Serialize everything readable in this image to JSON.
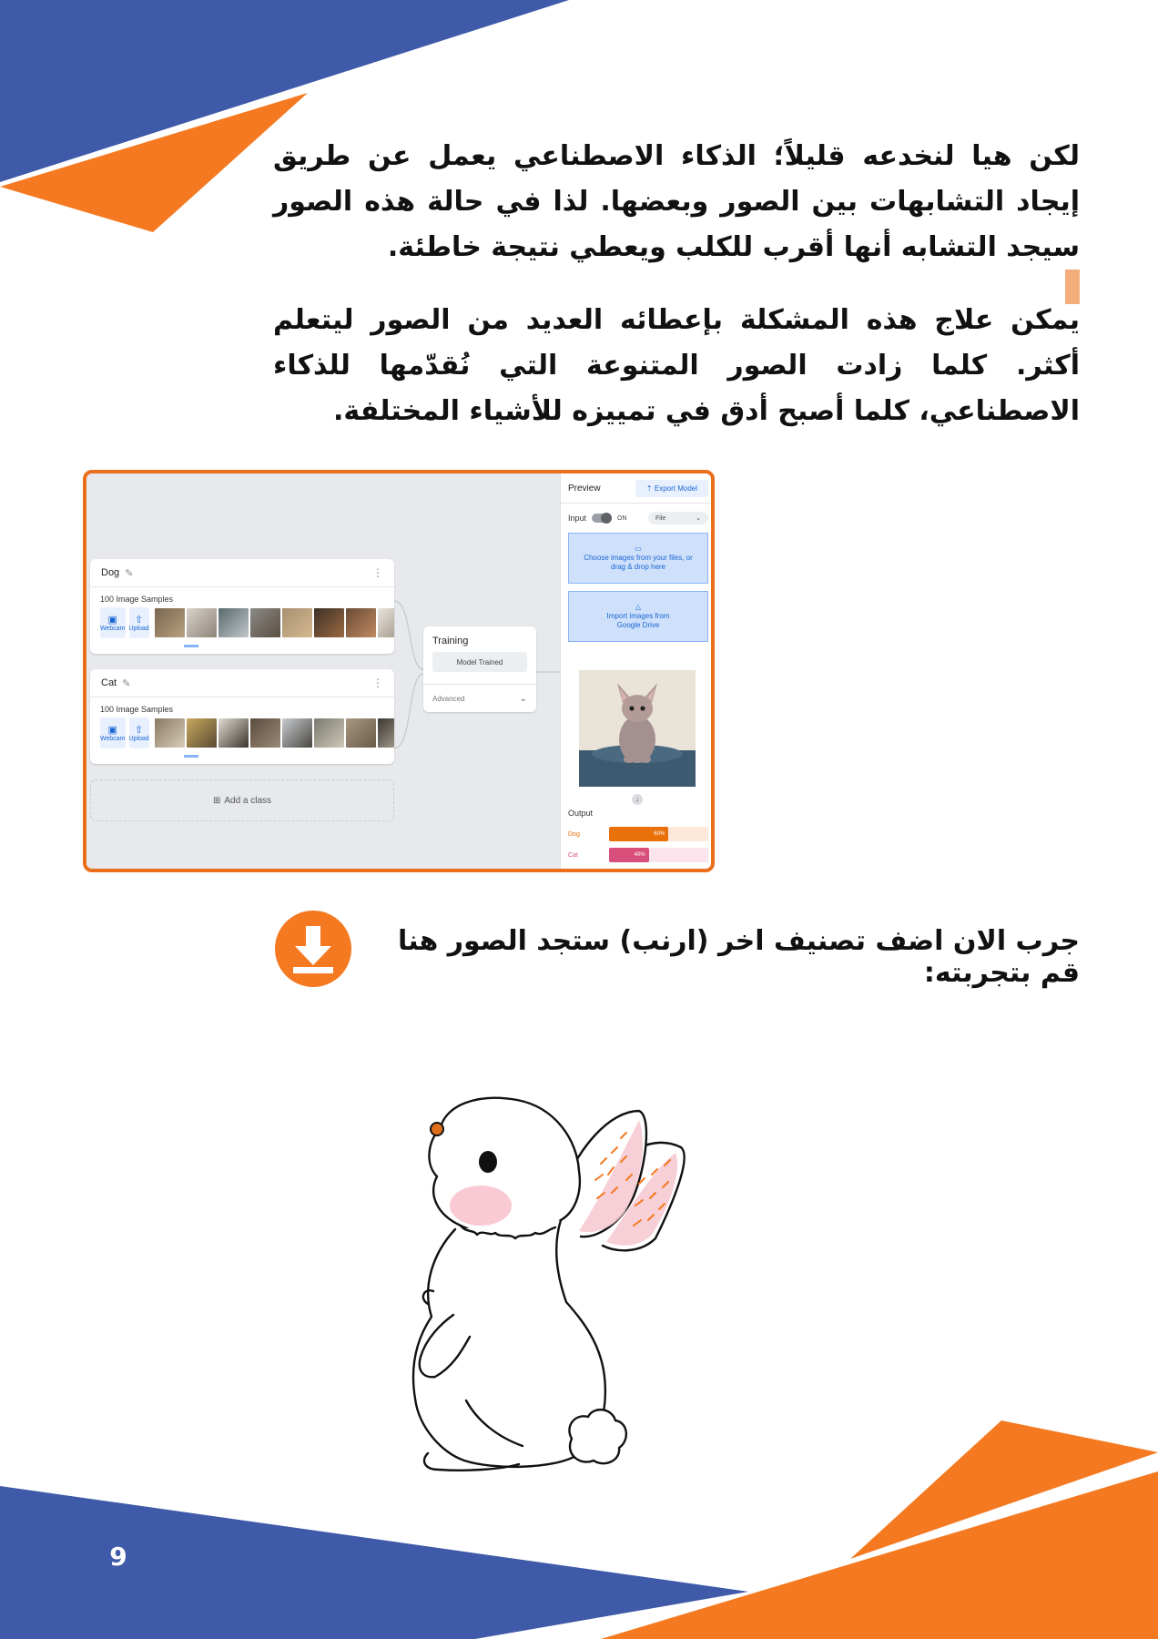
{
  "page": {
    "number": "9",
    "accent_color": "#f47920",
    "blue_color": "#3f5aa8"
  },
  "paragraphs": {
    "p1": "لكن هيا لنخدعه قليلاً؛ الذكاء الاصطناعي يعمل عن طريق إيجاد التشابهات بين الصور وبعضها. لذا في حالة هذه الصور سيجد التشابه أنها أقرب للكلب ويعطي نتيجة خاطئة.",
    "p2": "يمكن علاج هذه المشكلة بإعطائه العديد من الصور ليتعلم أكثر. كلما زادت الصور المتنوعة التي نُقدّمها للذكاء الاصطناعي، كلما أصبح أدق في تمييزه للأشياء المختلفة."
  },
  "screenshot": {
    "classes": [
      {
        "name": "Dog",
        "samples_label": "100 Image Samples",
        "webcam_label": "Webcam",
        "upload_label": "Upload"
      },
      {
        "name": "Cat",
        "samples_label": "100 Image Samples",
        "webcam_label": "Webcam",
        "upload_label": "Upload"
      }
    ],
    "add_class_label": "Add a class",
    "training": {
      "title": "Training",
      "button_label": "Model Trained",
      "advanced_label": "Advanced"
    },
    "preview": {
      "title": "Preview",
      "export_label": "Export Model",
      "input_label": "Input",
      "toggle_state": "ON",
      "source_select": "File",
      "choose_files_label": "Choose images from your files, or drag & drop here",
      "drive_label": "Import images from Google Drive",
      "output_title": "Output",
      "outputs": [
        {
          "label": "Dog",
          "percent_text": "60%",
          "value": 0.6,
          "color": "#e8710a",
          "track_color": "#fde8da"
        },
        {
          "label": "Cat",
          "percent_text": "40%",
          "value": 0.4,
          "color": "#d94f7b",
          "track_color": "#fce4ec"
        }
      ]
    }
  },
  "cta_text": "جرب الان اضف تصنيف اخر (ارنب) ستجد الصور هنا قم بتجربته:"
}
